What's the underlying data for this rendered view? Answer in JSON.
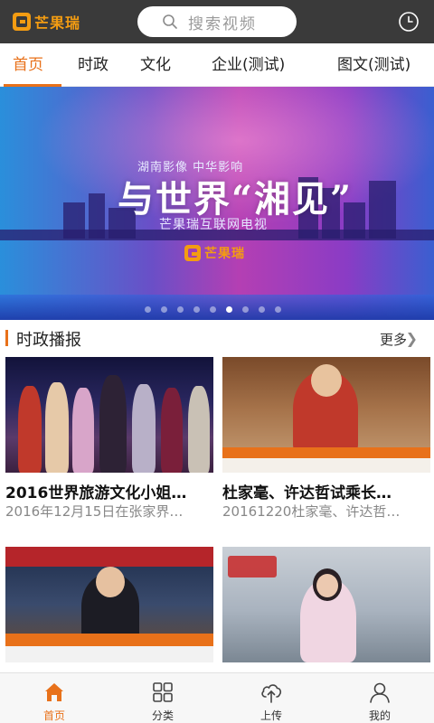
{
  "app": {
    "logo_text": "芒果瑞",
    "brand_color": "#e8711a",
    "topbar_color": "#3a3a3a"
  },
  "search": {
    "placeholder": "搜索视频",
    "icon": "search-icon"
  },
  "header": {
    "history_icon": "clock-icon"
  },
  "tabs": [
    {
      "label": "首页",
      "active": true
    },
    {
      "label": "时政",
      "active": false
    },
    {
      "label": "文化",
      "active": false
    },
    {
      "label": "企业(测试)",
      "active": false
    },
    {
      "label": "图文(测试)",
      "active": false
    }
  ],
  "banner": {
    "small_text": "湖南影像 中华影响",
    "title": "与世界“湘见”",
    "subtitle": "芒果瑞互联网电视",
    "logo_text": "芒果瑞",
    "dot_count": 9,
    "active_dot": 6
  },
  "section": {
    "title": "时政播报",
    "more_label": "更多",
    "more_icon": "chevron-right-icon"
  },
  "cards": [
    {
      "title": "2016世界旅游文化小姐…",
      "subtitle": "2016年12月15日在张家界…"
    },
    {
      "title": "杜家毫、许达哲试乘长…",
      "subtitle": "20161220杜家毫、许达哲…"
    },
    {
      "title": "",
      "subtitle": ""
    },
    {
      "title": "",
      "subtitle": ""
    }
  ],
  "bottom_nav": [
    {
      "label": "首页",
      "icon": "home-icon",
      "active": true
    },
    {
      "label": "分类",
      "icon": "grid-icon",
      "active": false
    },
    {
      "label": "上传",
      "icon": "upload-cloud-icon",
      "active": false
    },
    {
      "label": "我的",
      "icon": "user-icon",
      "active": false
    }
  ]
}
